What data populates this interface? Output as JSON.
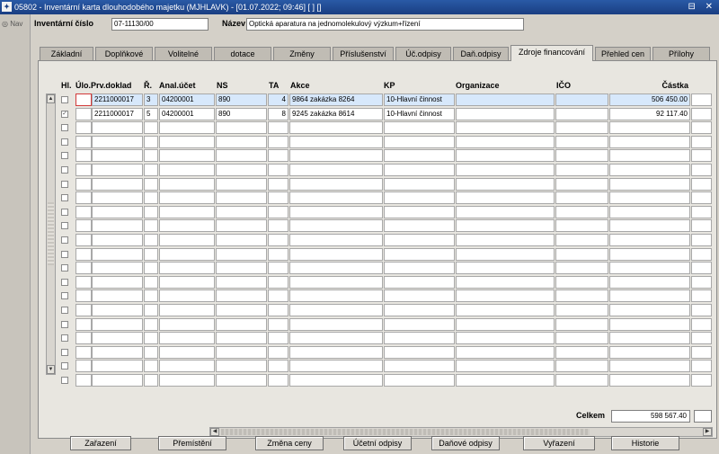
{
  "window": {
    "title": "05802 - Inventární karta dlouhodobého majetku (MJHLAVK) - [01.07.2022; 09:46] [ ] []",
    "controls": "⊟ ✕"
  },
  "nav": {
    "label": "◎ Nav"
  },
  "header": {
    "inventory_label": "Inventární číslo",
    "inventory_value": "07-11130/00",
    "name_label": "Název",
    "name_value": "Optická aparatura na jednomolekulový výzkum+řízení"
  },
  "tabs": [
    "Základní",
    "Doplňkové",
    "Volitelné",
    "dotace",
    "Změny",
    "Příslušenství",
    "Úč.odpisy",
    "Daň.odpisy",
    "Zdroje financování",
    "Přehled cen",
    "Přílohy"
  ],
  "active_tab": "Zdroje financování",
  "table": {
    "columns": [
      "Hl.",
      "Úlo.",
      "Prv.doklad",
      "Ř.",
      "Anal.účet",
      "NS",
      "TA",
      "Akce",
      "KP",
      "Organizace",
      "IČO",
      "Částka"
    ],
    "rows": [
      {
        "hl": "",
        "ulo": "",
        "prv_doklad": "2211000017",
        "r": "3",
        "anal_ucet": "04200001",
        "ns": "890",
        "ta": "4",
        "akce": "9864 zakázka 8264",
        "kp": "10-Hlavní činnost",
        "organizace": "",
        "ico": "",
        "castka": "506 450.00"
      },
      {
        "hl": "✓",
        "ulo": "",
        "prv_doklad": "2211000017",
        "r": "5",
        "anal_ucet": "04200001",
        "ns": "890",
        "ta": "8",
        "akce": "9245 zakázka 8614",
        "kp": "10-Hlavní činnost",
        "organizace": "",
        "ico": "",
        "castka": "92 117.40"
      }
    ]
  },
  "total": {
    "label": "Celkem",
    "value": "598 567.40"
  },
  "buttons": [
    "Zařazení",
    "Přemístění",
    "Změna ceny",
    "Účetní odpisy",
    "Daňové odpisy",
    "Vyřazení",
    "Historie"
  ]
}
